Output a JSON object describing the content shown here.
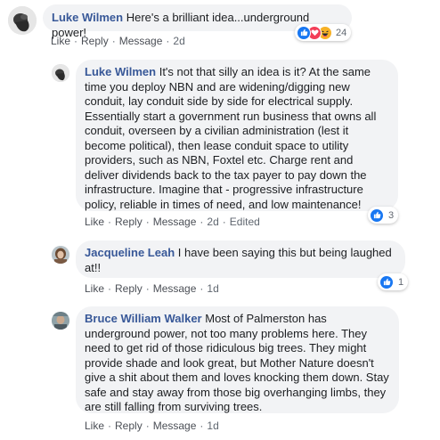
{
  "colors": {
    "name_link": "#385898",
    "bubble_bg": "#f2f3f5",
    "action_text": "#4b4f56",
    "like_blue": "#1877f2",
    "love_red": "#f33e58",
    "haha_yellow": "#f7b125"
  },
  "comments": [
    {
      "author": "Luke Wilmen",
      "text": "Here's a brilliant idea...underground power!",
      "actions": {
        "like": "Like",
        "reply": "Reply",
        "message": "Message",
        "time": "2d"
      },
      "reactions": {
        "icons": [
          "like-icon",
          "love-icon",
          "haha-icon"
        ],
        "count": "24"
      },
      "replies": [
        {
          "author": "Luke Wilmen",
          "text": "It's not that silly an idea is it? At the same time you deploy NBN and are widening/digging new conduit, lay conduit side by side for electrical supply. Essentially start a government run business that owns all conduit, overseen by a civilian administration (lest it become political), then lease conduit space to utility providers, such as NBN, Foxtel etc. Charge rent and deliver dividends back to the tax payer to pay down the infrastructure. Imagine that - progressive infrastructure policy, reliable in times of need, and low maintenance!",
          "actions": {
            "like": "Like",
            "reply": "Reply",
            "message": "Message",
            "time": "2d",
            "edited": "Edited"
          },
          "reactions": {
            "icons": [
              "like-icon"
            ],
            "count": "3"
          }
        },
        {
          "author": "Jacqueline Leah",
          "text": "I have been saying this but being laughed at!!",
          "actions": {
            "like": "Like",
            "reply": "Reply",
            "message": "Message",
            "time": "1d"
          },
          "reactions": {
            "icons": [
              "like-icon"
            ],
            "count": "1"
          }
        },
        {
          "author": "Bruce William Walker",
          "text": "Most of Palmerston has underground power, not too many problems here. They need to get rid of those ridiculous big trees. They might provide shade and look great, but Mother Nature doesn't give a shit about them and loves knocking them down. Stay safe and stay away from those big overhanging limbs, they are still falling from surviving trees.",
          "actions": {
            "like": "Like",
            "reply": "Reply",
            "message": "Message",
            "time": "1d"
          }
        }
      ]
    }
  ]
}
